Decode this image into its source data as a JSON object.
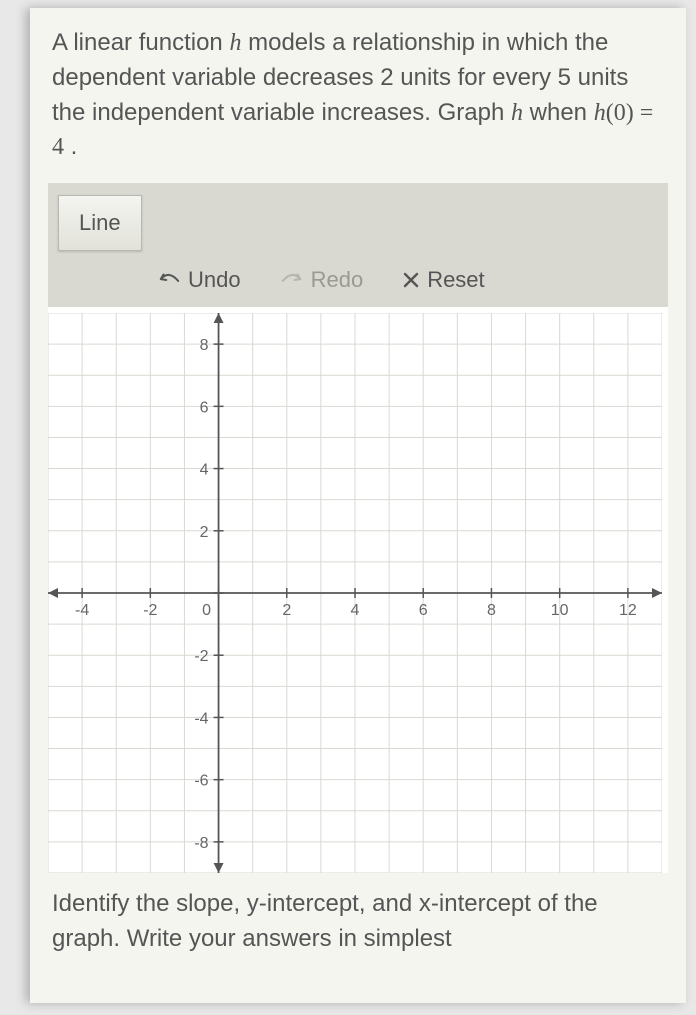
{
  "problem": {
    "line1_a": "A linear function ",
    "fn1": "h",
    "line1_b": " models a relationship in which the dependent variable decreases 2 units for every 5 units the independent variable increases. Graph ",
    "fn2": "h",
    "line1_c": " when ",
    "eq_lhs": "h",
    "eq_arg": "0",
    "eq_rhs": "4",
    "period": " ."
  },
  "tools": {
    "line_label": "Line",
    "undo_label": "Undo",
    "redo_label": "Redo",
    "reset_label": "Reset"
  },
  "chart_data": {
    "type": "scatter",
    "title": "",
    "xlabel": "",
    "ylabel": "",
    "xlim": [
      -5,
      13
    ],
    "ylim": [
      -9,
      9
    ],
    "x_ticks": [
      -4,
      -2,
      0,
      2,
      4,
      6,
      8,
      10,
      12
    ],
    "y_ticks": [
      -8,
      -6,
      -4,
      -2,
      0,
      2,
      4,
      6,
      8
    ],
    "x_tick_labels": [
      "-4",
      "-2",
      "0",
      "2",
      "4",
      "6",
      "8",
      "10",
      "12"
    ],
    "y_tick_labels": [
      "-8",
      "-6",
      "-4",
      "-2",
      "",
      "2",
      "4",
      "6",
      "8"
    ],
    "series": []
  },
  "footer": {
    "line1": "Identify the slope, ",
    "yint": "y",
    "line2": "-intercept, and ",
    "xint": "x",
    "line3": "-intercept of the graph. Write your answers in simplest"
  }
}
